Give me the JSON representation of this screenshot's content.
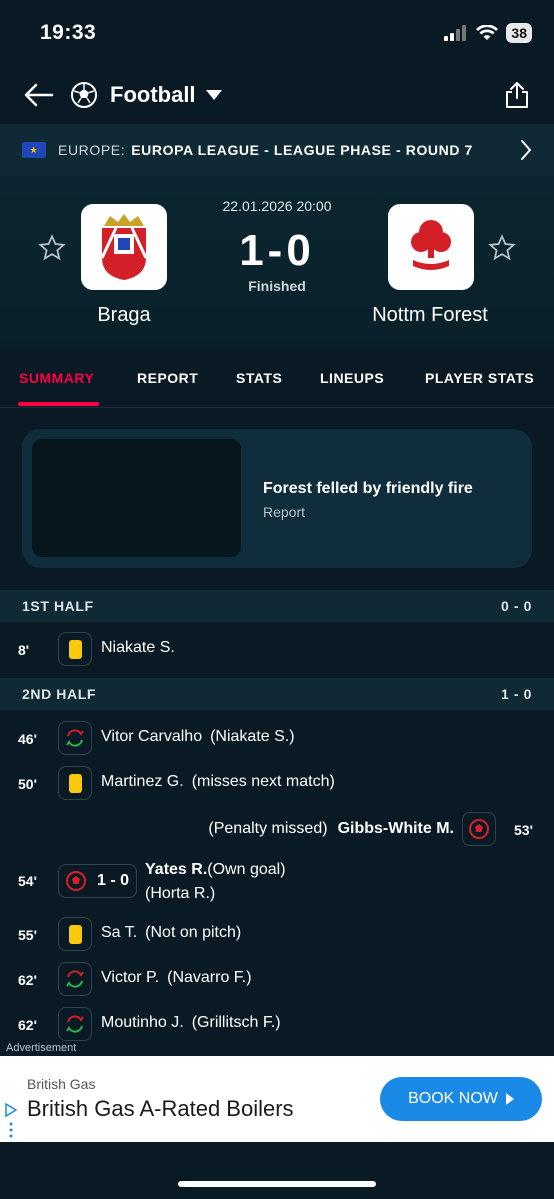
{
  "status": {
    "time": "19:33",
    "battery": "38"
  },
  "header": {
    "title": "Football"
  },
  "league": {
    "country": "EUROPE:",
    "competition": "EUROPA LEAGUE - LEAGUE PHASE - ROUND 7"
  },
  "match": {
    "datetime": "22.01.2026 20:00",
    "score": "1-0",
    "status": "Finished",
    "home": {
      "name": "Braga"
    },
    "away": {
      "name": "Nottm Forest"
    }
  },
  "tabs": [
    "SUMMARY",
    "REPORT",
    "STATS",
    "LINEUPS",
    "PLAYER STATS"
  ],
  "news": {
    "title": "Forest felled by friendly fire",
    "subtitle": "Report"
  },
  "halves": [
    {
      "label": "1ST HALF",
      "score": "0 - 0"
    },
    {
      "label": "2ND HALF",
      "score": "1 - 0"
    }
  ],
  "events": [
    {
      "minute": "8'",
      "player": "Niakate S.",
      "detail": ""
    },
    {
      "minute": "46'",
      "player": "Vitor Carvalho",
      "detail": "(Niakate S.)"
    },
    {
      "minute": "50'",
      "player": "Martinez G.",
      "detail": "(misses next match)"
    },
    {
      "minute": "53'",
      "player": "Gibbs-White M.",
      "detail": "(Penalty missed)"
    },
    {
      "minute": "54'",
      "score": "1 - 0",
      "player": "Yates R.",
      "detail": "(Own goal)",
      "assist": "(Horta R.)"
    },
    {
      "minute": "55'",
      "player": "Sa T.",
      "detail": "(Not on pitch)"
    },
    {
      "minute": "62'",
      "player": "Victor P.",
      "detail": "(Navarro F.)"
    },
    {
      "minute": "62'",
      "player": "Moutinho J.",
      "detail": "(Grillitsch F.)"
    }
  ],
  "ad": {
    "label": "Advertisement",
    "brand": "British Gas",
    "headline": "British Gas A-Rated Boilers",
    "cta": "BOOK NOW"
  },
  "colors": {
    "accent": "#ff0046",
    "yellow_card": "#f8c90b",
    "cta": "#1a8ae6",
    "background": "#0a1a24"
  }
}
